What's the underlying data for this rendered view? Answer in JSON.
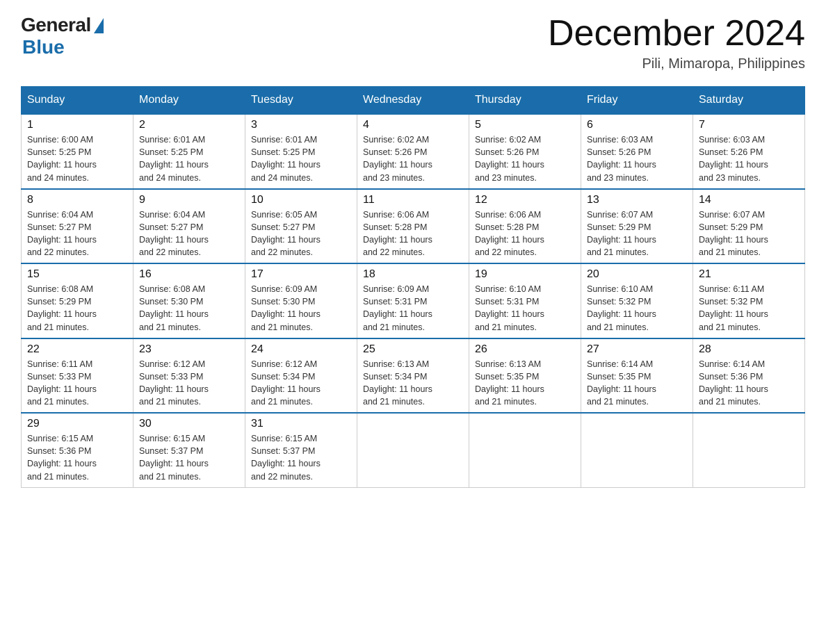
{
  "logo": {
    "general": "General",
    "blue": "Blue"
  },
  "header": {
    "month_year": "December 2024",
    "location": "Pili, Mimaropa, Philippines"
  },
  "weekdays": [
    "Sunday",
    "Monday",
    "Tuesday",
    "Wednesday",
    "Thursday",
    "Friday",
    "Saturday"
  ],
  "weeks": [
    [
      {
        "day": "1",
        "sunrise": "6:00 AM",
        "sunset": "5:25 PM",
        "daylight": "11 hours and 24 minutes."
      },
      {
        "day": "2",
        "sunrise": "6:01 AM",
        "sunset": "5:25 PM",
        "daylight": "11 hours and 24 minutes."
      },
      {
        "day": "3",
        "sunrise": "6:01 AM",
        "sunset": "5:25 PM",
        "daylight": "11 hours and 24 minutes."
      },
      {
        "day": "4",
        "sunrise": "6:02 AM",
        "sunset": "5:26 PM",
        "daylight": "11 hours and 23 minutes."
      },
      {
        "day": "5",
        "sunrise": "6:02 AM",
        "sunset": "5:26 PM",
        "daylight": "11 hours and 23 minutes."
      },
      {
        "day": "6",
        "sunrise": "6:03 AM",
        "sunset": "5:26 PM",
        "daylight": "11 hours and 23 minutes."
      },
      {
        "day": "7",
        "sunrise": "6:03 AM",
        "sunset": "5:26 PM",
        "daylight": "11 hours and 23 minutes."
      }
    ],
    [
      {
        "day": "8",
        "sunrise": "6:04 AM",
        "sunset": "5:27 PM",
        "daylight": "11 hours and 22 minutes."
      },
      {
        "day": "9",
        "sunrise": "6:04 AM",
        "sunset": "5:27 PM",
        "daylight": "11 hours and 22 minutes."
      },
      {
        "day": "10",
        "sunrise": "6:05 AM",
        "sunset": "5:27 PM",
        "daylight": "11 hours and 22 minutes."
      },
      {
        "day": "11",
        "sunrise": "6:06 AM",
        "sunset": "5:28 PM",
        "daylight": "11 hours and 22 minutes."
      },
      {
        "day": "12",
        "sunrise": "6:06 AM",
        "sunset": "5:28 PM",
        "daylight": "11 hours and 22 minutes."
      },
      {
        "day": "13",
        "sunrise": "6:07 AM",
        "sunset": "5:29 PM",
        "daylight": "11 hours and 21 minutes."
      },
      {
        "day": "14",
        "sunrise": "6:07 AM",
        "sunset": "5:29 PM",
        "daylight": "11 hours and 21 minutes."
      }
    ],
    [
      {
        "day": "15",
        "sunrise": "6:08 AM",
        "sunset": "5:29 PM",
        "daylight": "11 hours and 21 minutes."
      },
      {
        "day": "16",
        "sunrise": "6:08 AM",
        "sunset": "5:30 PM",
        "daylight": "11 hours and 21 minutes."
      },
      {
        "day": "17",
        "sunrise": "6:09 AM",
        "sunset": "5:30 PM",
        "daylight": "11 hours and 21 minutes."
      },
      {
        "day": "18",
        "sunrise": "6:09 AM",
        "sunset": "5:31 PM",
        "daylight": "11 hours and 21 minutes."
      },
      {
        "day": "19",
        "sunrise": "6:10 AM",
        "sunset": "5:31 PM",
        "daylight": "11 hours and 21 minutes."
      },
      {
        "day": "20",
        "sunrise": "6:10 AM",
        "sunset": "5:32 PM",
        "daylight": "11 hours and 21 minutes."
      },
      {
        "day": "21",
        "sunrise": "6:11 AM",
        "sunset": "5:32 PM",
        "daylight": "11 hours and 21 minutes."
      }
    ],
    [
      {
        "day": "22",
        "sunrise": "6:11 AM",
        "sunset": "5:33 PM",
        "daylight": "11 hours and 21 minutes."
      },
      {
        "day": "23",
        "sunrise": "6:12 AM",
        "sunset": "5:33 PM",
        "daylight": "11 hours and 21 minutes."
      },
      {
        "day": "24",
        "sunrise": "6:12 AM",
        "sunset": "5:34 PM",
        "daylight": "11 hours and 21 minutes."
      },
      {
        "day": "25",
        "sunrise": "6:13 AM",
        "sunset": "5:34 PM",
        "daylight": "11 hours and 21 minutes."
      },
      {
        "day": "26",
        "sunrise": "6:13 AM",
        "sunset": "5:35 PM",
        "daylight": "11 hours and 21 minutes."
      },
      {
        "day": "27",
        "sunrise": "6:14 AM",
        "sunset": "5:35 PM",
        "daylight": "11 hours and 21 minutes."
      },
      {
        "day": "28",
        "sunrise": "6:14 AM",
        "sunset": "5:36 PM",
        "daylight": "11 hours and 21 minutes."
      }
    ],
    [
      {
        "day": "29",
        "sunrise": "6:15 AM",
        "sunset": "5:36 PM",
        "daylight": "11 hours and 21 minutes."
      },
      {
        "day": "30",
        "sunrise": "6:15 AM",
        "sunset": "5:37 PM",
        "daylight": "11 hours and 21 minutes."
      },
      {
        "day": "31",
        "sunrise": "6:15 AM",
        "sunset": "5:37 PM",
        "daylight": "11 hours and 22 minutes."
      },
      null,
      null,
      null,
      null
    ]
  ],
  "labels": {
    "sunrise_prefix": "Sunrise: ",
    "sunset_prefix": "Sunset: ",
    "daylight_prefix": "Daylight: "
  }
}
